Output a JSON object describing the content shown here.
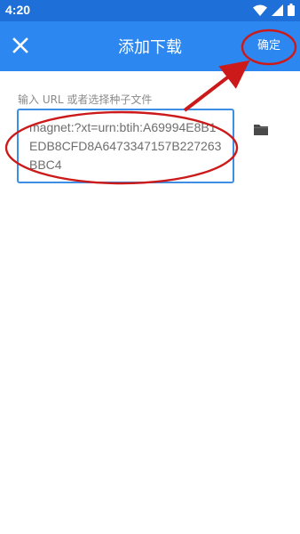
{
  "status_bar": {
    "time": "4:20",
    "icons": [
      "wifi-icon",
      "signal-icon",
      "battery-icon"
    ]
  },
  "app_bar": {
    "title": "添加下载",
    "close_icon": "close-icon",
    "confirm_label": "确定",
    "background": "#2d87f0"
  },
  "form": {
    "label": "输入 URL 或者选择种子文件",
    "url_value": "magnet:?xt=urn:btih:A69994E8B1EDB8CFD8A6473347157B227263BBC4",
    "folder_icon": "folder-icon",
    "accent": "#3d8fe6"
  },
  "annotation": {
    "color": "#cc1a1a",
    "shapes": [
      "ellipse",
      "ellipse",
      "arrow"
    ]
  }
}
